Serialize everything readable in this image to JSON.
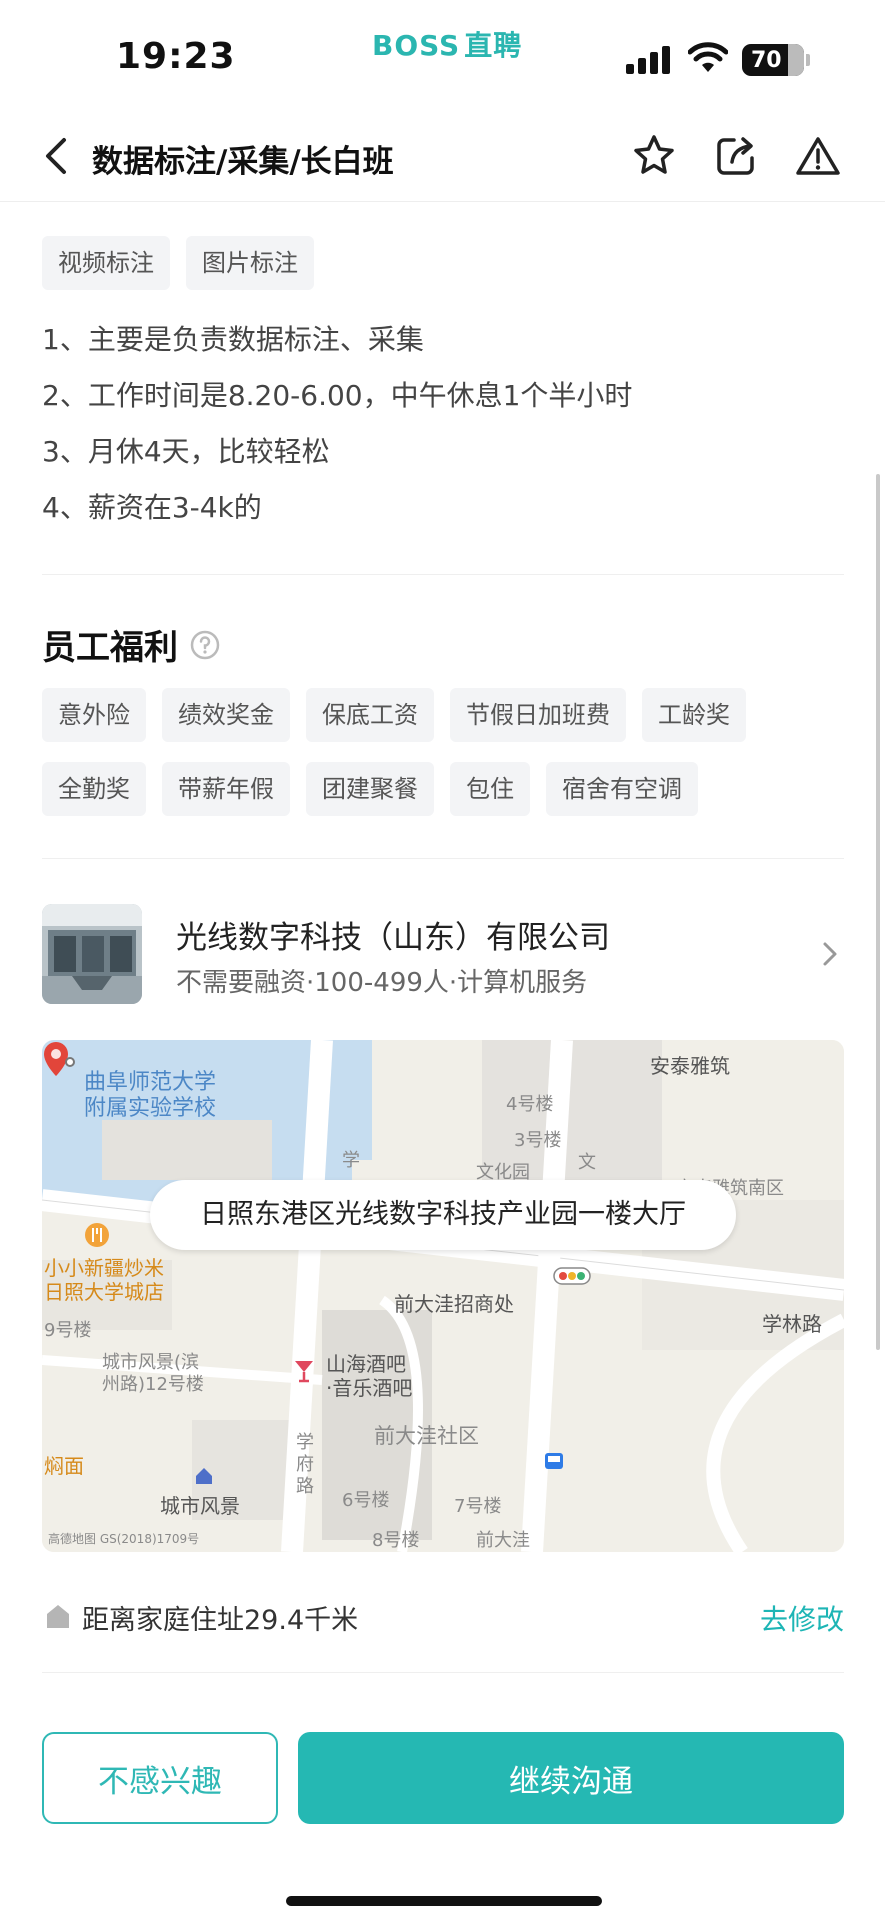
{
  "status_bar": {
    "time": "19:23",
    "brand_en": "BOSS",
    "brand_cn": "直聘",
    "brand_color": "#2bb6b0",
    "battery": "70"
  },
  "nav": {
    "back_icon": "chevron-left-icon",
    "title": "数据标注/采集/长白班",
    "icons": [
      "star-icon",
      "share-icon",
      "warning-icon"
    ]
  },
  "skill_tags": [
    "视频标注",
    "图片标注"
  ],
  "description": [
    "1、主要是负责数据标注、采集",
    "2、工作时间是8.20-6.00，中午休息1个半小时",
    "3、月休4天，比较轻松",
    "4、薪资在3-4k的"
  ],
  "benefits": {
    "title": "员工福利",
    "help_icon": "question-circle-icon",
    "row1": [
      "意外险",
      "绩效奖金",
      "保底工资",
      "节假日加班费",
      "工龄奖"
    ],
    "row2": [
      "全勤奖",
      "带薪年假",
      "团建聚餐",
      "包住",
      "宿舍有空调"
    ]
  },
  "company": {
    "name": "光线数字科技（山东）有限公司",
    "meta": "不需要融资·100-499人·计算机服务"
  },
  "map": {
    "address": "日照东港区光线数字科技产业园一楼大厅",
    "labels": {
      "school": "曲阜师范大学",
      "school2": "附属实验学校",
      "antai": "安泰雅筑",
      "b4": "4号楼",
      "b3": "3号楼",
      "wenhua": "文化园",
      "yazhu_south": "安泰雅筑南区",
      "restaurant": "小小新疆炒米",
      "restaurant2": "日照大学城店",
      "b9": "9号楼",
      "office": "前大洼招商处",
      "xuelin": "学林路",
      "fengjing12": "城市风景(滨",
      "fengjing12b": "州路)12号楼",
      "bar": "山海酒吧",
      "bar2": "·音乐酒吧",
      "community": "前大洼社区",
      "noodle": "焖面",
      "fengjing": "城市风景",
      "b6": "6号楼",
      "b7": "7号楼",
      "b8": "8号楼",
      "qiandawa": "前大洼",
      "road_xuefu": "学府路",
      "road_xue": "学",
      "road_wen": "文",
      "copyright": "高德地图 GS(2018)1709号"
    }
  },
  "distance": {
    "text": "距离家庭住址29.4千米",
    "edit": "去修改"
  },
  "actions": {
    "not_interested": "不感兴趣",
    "continue_chat": "继续沟通",
    "accent_color": "#25b8b3"
  }
}
